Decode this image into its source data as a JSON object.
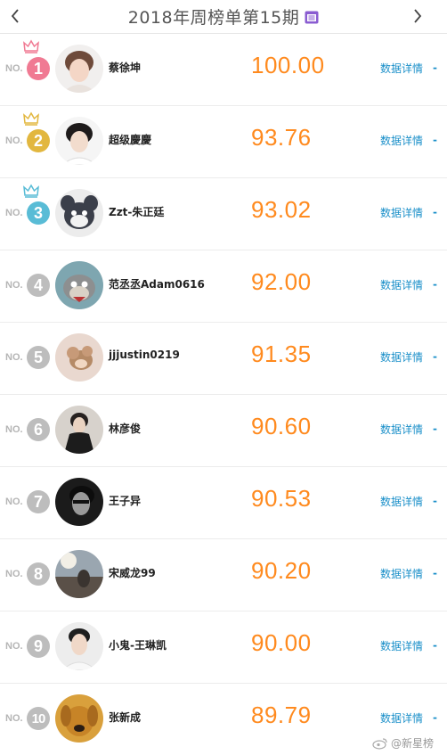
{
  "header": {
    "title": "2018年周榜单第15期",
    "prev_icon": "chevron-left-icon",
    "next_icon": "chevron-right-icon",
    "calendar_icon": "calendar-icon",
    "calendar_color": "#8a5cd1"
  },
  "no_label": "NO.",
  "detail_label": "数据详情",
  "detail_dash": "-",
  "colors": {
    "score": "#ff8a1e",
    "link": "#1a8fc9",
    "rank1": "#f07a93",
    "rank2": "#e2b73f",
    "rank3": "#59bcd6",
    "rank_other": "#bdbdbd"
  },
  "rows": [
    {
      "rank": "1",
      "name": "蔡徐坤",
      "score": "100.00"
    },
    {
      "rank": "2",
      "name": "超级慶慶",
      "score": "93.76"
    },
    {
      "rank": "3",
      "name": "Zzt-朱正廷",
      "score": "93.02"
    },
    {
      "rank": "4",
      "name": "范丞丞Adam0616",
      "score": "92.00"
    },
    {
      "rank": "5",
      "name": "jjjustin0219",
      "score": "91.35"
    },
    {
      "rank": "6",
      "name": "林彦俊",
      "score": "90.60"
    },
    {
      "rank": "7",
      "name": "王子异",
      "score": "90.53"
    },
    {
      "rank": "8",
      "name": "宋威龙99",
      "score": "90.20"
    },
    {
      "rank": "9",
      "name": "小鬼-王琳凯",
      "score": "90.00"
    },
    {
      "rank": "10",
      "name": "张新成",
      "score": "89.79"
    }
  ],
  "watermark": "@新星榜"
}
